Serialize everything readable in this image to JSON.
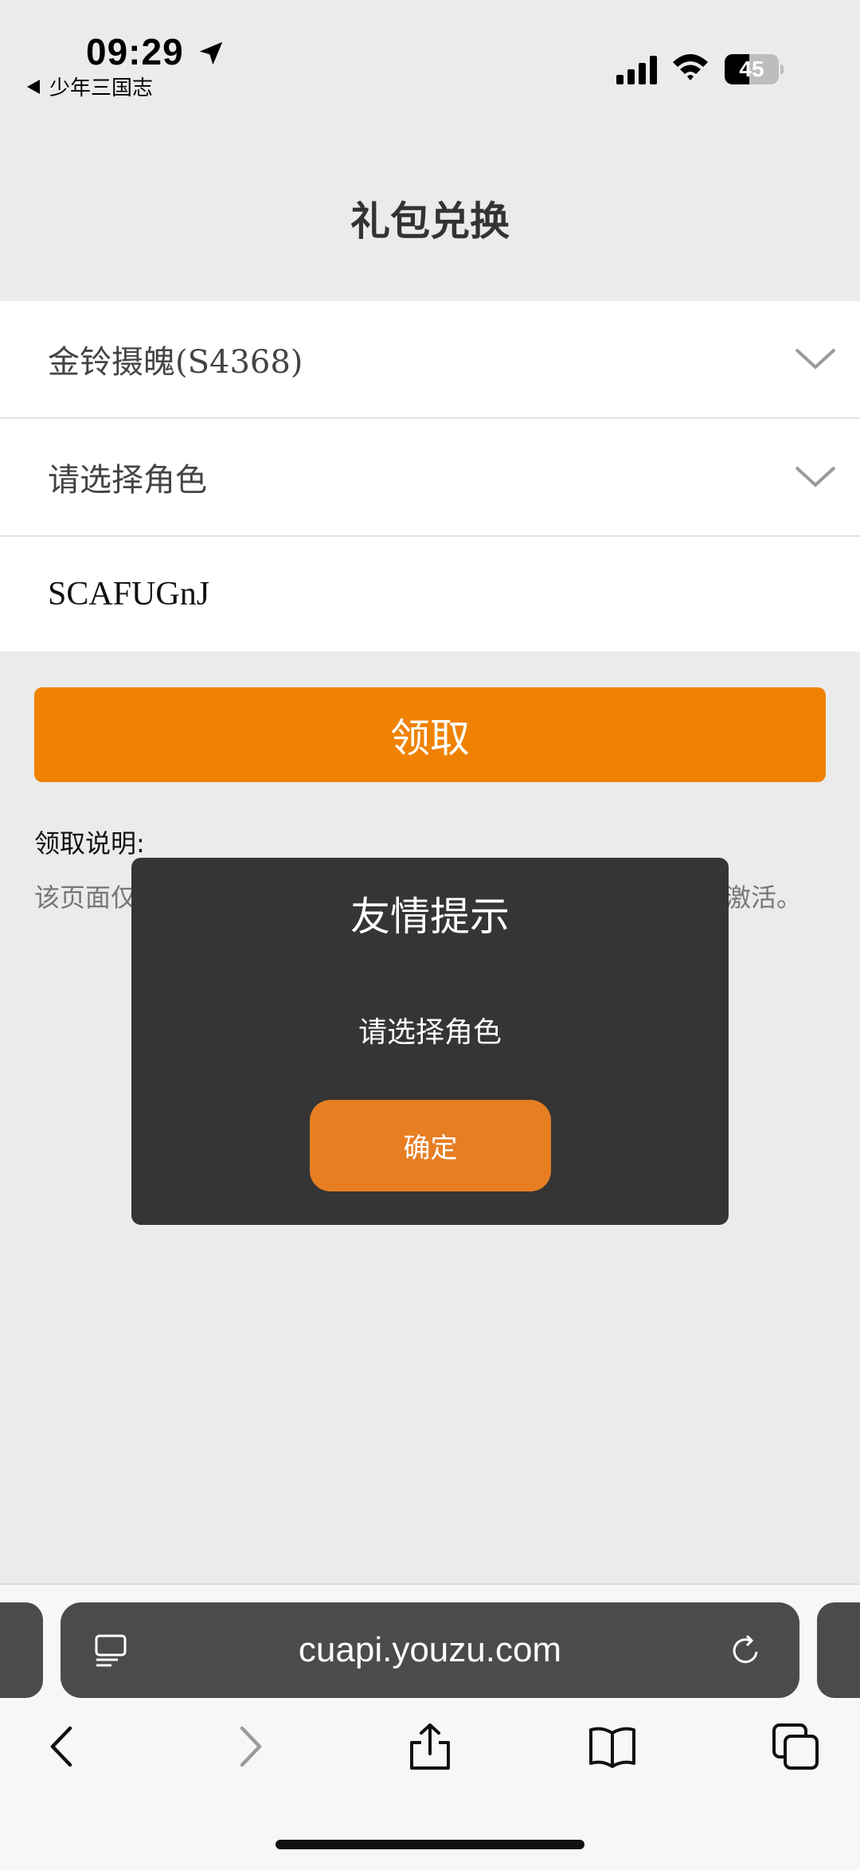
{
  "status_bar": {
    "time": "09:29",
    "back_app": "少年三国志",
    "battery_level": "45",
    "battery_fraction": 0.45
  },
  "header": {
    "title": "礼包兑换"
  },
  "form": {
    "server": "金铃摄魄(S4368)",
    "role_placeholder": "请选择角色",
    "code": "SCAFUGnJ"
  },
  "claim_button": {
    "label": "领取"
  },
  "instructions": {
    "title": "领取说明:",
    "body_left": "该页面仅",
    "body_right": "激活。"
  },
  "modal": {
    "title": "友情提示",
    "message": "请选择角色",
    "ok_label": "确定"
  },
  "browser": {
    "url": "cuapi.youzu.com"
  },
  "colors": {
    "accent": "#ef8203",
    "modal_button": "#e87e22",
    "modal_bg": "#353535",
    "page_bg": "#ebebeb"
  },
  "icons": [
    "location-arrow-icon",
    "signal-icon",
    "wifi-icon",
    "battery-icon",
    "chevron-down-icon",
    "reader-icon",
    "reload-icon",
    "back-icon",
    "forward-icon",
    "share-icon",
    "bookmarks-icon",
    "tabs-icon"
  ]
}
